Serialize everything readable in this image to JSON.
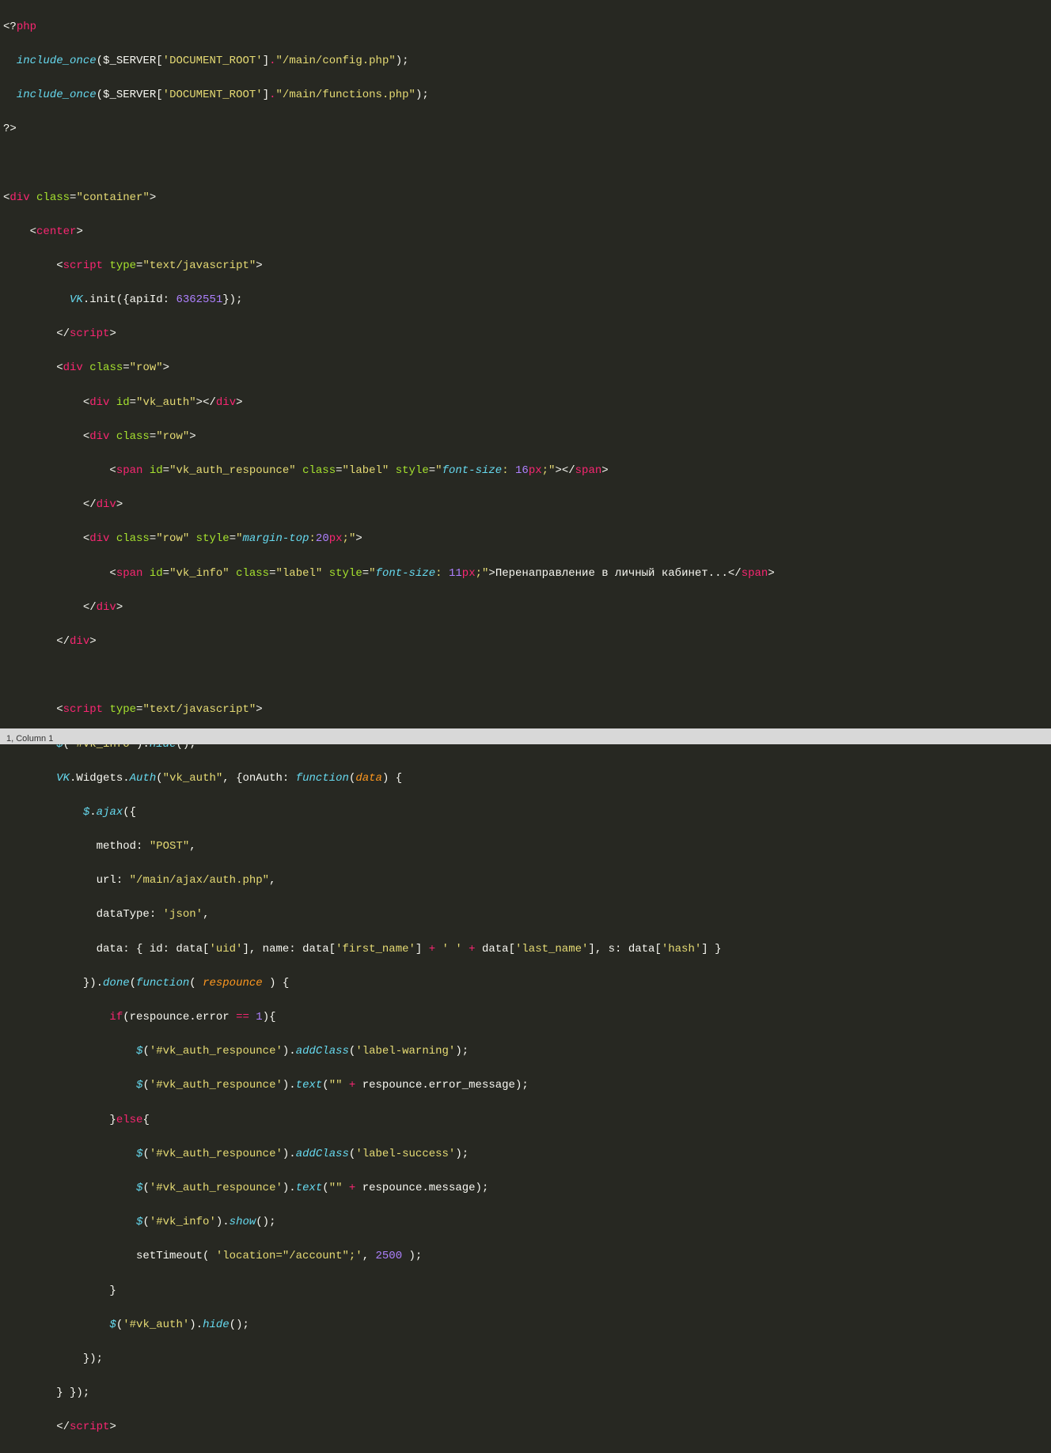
{
  "status": {
    "text": "1, Column 1"
  },
  "code": {
    "l1": {
      "a": "<?",
      "b": "php"
    },
    "l2": {
      "a": "include_once",
      "b": "(",
      "c": "$_SERVER",
      "d": "[",
      "e": "'DOCUMENT_ROOT'",
      "f": "]",
      "g": ".",
      "h": "\"/main/config.php\"",
      "i": ");"
    },
    "l3": {
      "a": "include_once",
      "b": "(",
      "c": "$_SERVER",
      "d": "[",
      "e": "'DOCUMENT_ROOT'",
      "f": "]",
      "g": ".",
      "h": "\"/main/functions.php\"",
      "i": ");"
    },
    "l4": {
      "a": "?>"
    },
    "l5": {
      "a": ""
    },
    "l6": {
      "a": "<",
      "b": "div ",
      "c": "class",
      "d": "=",
      "e": "\"container\"",
      "f": ">"
    },
    "l7": {
      "a": "    <",
      "b": "center",
      "c": ">"
    },
    "l8": {
      "a": "        <",
      "b": "script ",
      "c": "type",
      "d": "=",
      "e": "\"text/javascript\"",
      "f": ">"
    },
    "l9": {
      "a": "          ",
      "b": "VK",
      "c": ".init({apiId: ",
      "d": "6362551",
      "e": "});"
    },
    "l10": {
      "a": "        </",
      "b": "script",
      "c": ">"
    },
    "l11": {
      "a": "        <",
      "b": "div ",
      "c": "class",
      "d": "=",
      "e": "\"row\"",
      "f": ">"
    },
    "l12": {
      "a": "            <",
      "b": "div ",
      "c": "id",
      "d": "=",
      "e": "\"vk_auth\"",
      "f": "></",
      "g": "div",
      "h": ">"
    },
    "l13": {
      "a": "            <",
      "b": "div ",
      "c": "class",
      "d": "=",
      "e": "\"row\"",
      "f": ">"
    },
    "l14": {
      "a": "                <",
      "b": "span ",
      "c": "id",
      "d": "=",
      "e": "\"vk_auth_respounce\" ",
      "f": "class",
      "g": "=",
      "h": "\"label\" ",
      "i": "style",
      "j": "=",
      "k": "\"",
      "l": "font-size",
      "m": ": ",
      "n": "16",
      "o": "px",
      "p": ";",
      "q": "\"",
      "r": "></",
      "s": "span",
      "t": ">"
    },
    "l15": {
      "a": "            </",
      "b": "div",
      "c": ">"
    },
    "l16": {
      "a": "            <",
      "b": "div ",
      "c": "class",
      "d": "=",
      "e": "\"row\" ",
      "f": "style",
      "g": "=",
      "h": "\"",
      "i": "margin-top",
      "j": ":",
      "k": "20",
      "l": "px",
      "m": ";",
      "n": "\"",
      "o": ">"
    },
    "l17": {
      "a": "                <",
      "b": "span ",
      "c": "id",
      "d": "=",
      "e": "\"vk_info\" ",
      "f": "class",
      "g": "=",
      "h": "\"label\" ",
      "i": "style",
      "j": "=",
      "k": "\"",
      "l": "font-size",
      "m": ": ",
      "n": "11",
      "o": "px",
      "p": ";",
      "q": "\"",
      "r": ">",
      "s": "Перенаправление в личный кабинет...",
      "t": "</",
      "u": "span",
      "v": ">"
    },
    "l18": {
      "a": "            </",
      "b": "div",
      "c": ">"
    },
    "l19": {
      "a": "        </",
      "b": "div",
      "c": ">"
    },
    "l20": {
      "a": ""
    },
    "l21": {
      "a": "        <",
      "b": "script ",
      "c": "type",
      "d": "=",
      "e": "\"text/javascript\"",
      "f": ">"
    },
    "l22": {
      "a": "        ",
      "b": "$",
      "c": "(",
      "d": "'#vk_info'",
      "e": ").",
      "f": "hide",
      "g": "();"
    },
    "l23": {
      "a": "        ",
      "b": "VK",
      "c": ".Widgets.",
      "d": "Auth",
      "e": "(",
      "f": "\"vk_auth\"",
      "g": ", {onAuth: ",
      "h": "function",
      "i": "(",
      "j": "data",
      "k": ") {"
    },
    "l24": {
      "a": "            ",
      "b": "$",
      "c": ".",
      "d": "ajax",
      "e": "({"
    },
    "l25": {
      "a": "              method: ",
      "b": "\"POST\"",
      "c": ","
    },
    "l26": {
      "a": "              url: ",
      "b": "\"/main/ajax/auth.php\"",
      "c": ","
    },
    "l27": {
      "a": "              dataType: ",
      "b": "'json'",
      "c": ","
    },
    "l28": {
      "a": "              data: { id: data[",
      "b": "'uid'",
      "c": "], name: data[",
      "d": "'first_name'",
      "e": "] ",
      "f": "+",
      "g": " ",
      "h": "' '",
      "i": " ",
      "j": "+",
      "k": " data[",
      "l": "'last_name'",
      "m": "], s: data[",
      "n": "'hash'",
      "o": "] }"
    },
    "l29": {
      "a": "            }).",
      "b": "done",
      "c": "(",
      "d": "function",
      "e": "( ",
      "f": "respounce",
      "g": " ) {"
    },
    "l30": {
      "a": "                ",
      "b": "if",
      "c": "(respounce.error ",
      "d": "==",
      "e": " ",
      "f": "1",
      "g": "){"
    },
    "l31": {
      "a": "                    ",
      "b": "$",
      "c": "(",
      "d": "'#vk_auth_respounce'",
      "e": ").",
      "f": "addClass",
      "g": "(",
      "h": "'label-warning'",
      "i": ");"
    },
    "l32": {
      "a": "                    ",
      "b": "$",
      "c": "(",
      "d": "'#vk_auth_respounce'",
      "e": ").",
      "f": "text",
      "g": "(",
      "h": "\"\"",
      "i": " ",
      "j": "+",
      "k": " respounce.error_message);"
    },
    "l33": {
      "a": "                }",
      "b": "else",
      "c": "{"
    },
    "l34": {
      "a": "                    ",
      "b": "$",
      "c": "(",
      "d": "'#vk_auth_respounce'",
      "e": ").",
      "f": "addClass",
      "g": "(",
      "h": "'label-success'",
      "i": ");"
    },
    "l35": {
      "a": "                    ",
      "b": "$",
      "c": "(",
      "d": "'#vk_auth_respounce'",
      "e": ").",
      "f": "text",
      "g": "(",
      "h": "\"\"",
      "i": " ",
      "j": "+",
      "k": " respounce.message);"
    },
    "l36": {
      "a": "                    ",
      "b": "$",
      "c": "(",
      "d": "'#vk_info'",
      "e": ").",
      "f": "show",
      "g": "();"
    },
    "l37": {
      "a": "                    setTimeout( ",
      "b": "'location=\"/account\";'",
      "c": ", ",
      "d": "2500",
      "e": " );"
    },
    "l38": {
      "a": "                }"
    },
    "l39": {
      "a": "                ",
      "b": "$",
      "c": "(",
      "d": "'#vk_auth'",
      "e": ").",
      "f": "hide",
      "g": "();"
    },
    "l40": {
      "a": "            });"
    },
    "l41": {
      "a": "        } });"
    },
    "l42": {
      "a": "        </",
      "b": "script",
      "c": ">"
    }
  }
}
